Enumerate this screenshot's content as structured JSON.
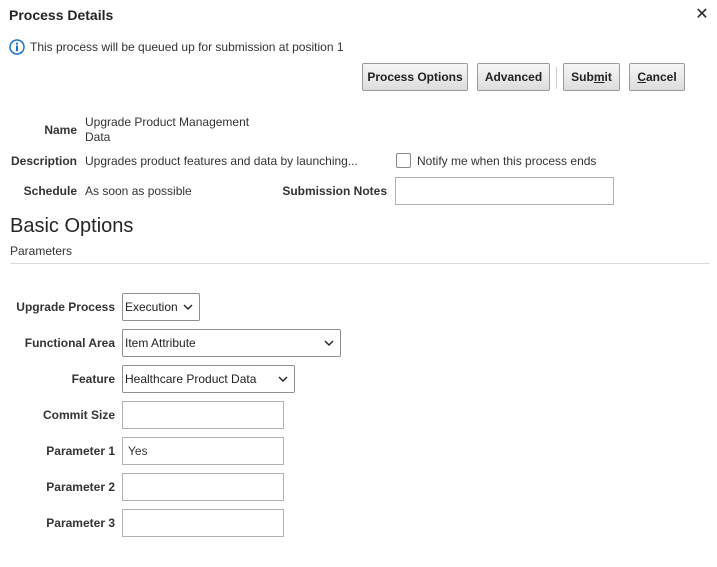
{
  "dialog": {
    "title": "Process Details",
    "close_glyph": "✕"
  },
  "info": {
    "icon": "info-icon",
    "message": "This process will be queued up for submission at position 1"
  },
  "toolbar": {
    "process_options_label": "Process Options",
    "advanced_label": "Advanced",
    "submit_label_pre": "Sub",
    "submit_label_mnemonic": "m",
    "submit_label_post": "it",
    "cancel_label_mnemonic": "C",
    "cancel_label_post": "ancel"
  },
  "details": {
    "name_label": "Name",
    "name_line1": "Upgrade Product Management",
    "name_line2": "Data",
    "description_label": "Description",
    "description_value": "Upgrades product features and data by launching...",
    "notify_label": "Notify me when this process ends",
    "notify_checked": false,
    "schedule_label": "Schedule",
    "schedule_value": "As soon as possible",
    "submission_notes_label": "Submission Notes",
    "submission_notes_value": ""
  },
  "basic_options": {
    "title": "Basic Options",
    "subtitle": "Parameters"
  },
  "parameters": {
    "upgrade_process_label": "Upgrade Process",
    "upgrade_process_value": "Execution",
    "functional_area_label": "Functional Area",
    "functional_area_value": "Item Attribute",
    "feature_label": "Feature",
    "feature_value": "Healthcare Product Data",
    "commit_size_label": "Commit Size",
    "commit_size_value": "",
    "parameter1_label": "Parameter 1",
    "parameter1_value": "Yes",
    "parameter2_label": "Parameter 2",
    "parameter2_value": "",
    "parameter3_label": "Parameter 3",
    "parameter3_value": ""
  },
  "colors": {
    "info_icon": "#1a73c9",
    "text": "#333333",
    "border": "#b0b0b0"
  }
}
